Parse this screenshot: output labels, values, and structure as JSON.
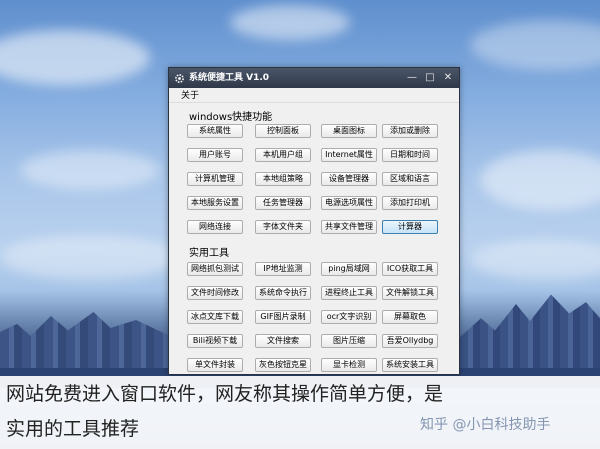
{
  "window": {
    "title": "系统便捷工具 V1.0",
    "minimize_glyph": "—",
    "maximize_glyph": "□",
    "close_glyph": "✕",
    "app_icon": "gear-icon"
  },
  "menu": {
    "about": "关于"
  },
  "group1": {
    "label": "windows快捷功能",
    "rows": [
      [
        "系统属性",
        "控制面板",
        "桌面图标",
        "添加或删除"
      ],
      [
        "用户账号",
        "本机用户组",
        "Internet属性",
        "日期和时间"
      ],
      [
        "计算机管理",
        "本地组策略",
        "设备管理器",
        "区域和语言"
      ],
      [
        "本地服务设置",
        "任务管理器",
        "电源选项属性",
        "添加打印机"
      ],
      [
        "网络连接",
        "字体文件夹",
        "共享文件管理",
        "计算器"
      ]
    ]
  },
  "group2": {
    "label": "实用工具",
    "rows": [
      [
        "网络抓包测试",
        "IP地址监测",
        "ping局域网",
        "ICO获取工具"
      ],
      [
        "文件时间修改",
        "系统命令执行",
        "进程终止工具",
        "文件解锁工具"
      ],
      [
        "冰点文库下载",
        "GIF图片录制",
        "ocr文字识别",
        "屏幕取色"
      ],
      [
        "Bili视频下载",
        "文件搜索",
        "图片压缩",
        "吾爱Ollydbg"
      ],
      [
        "单文件封装",
        "灰色按钮克星",
        "显卡检测",
        "系统安装工具"
      ]
    ]
  },
  "caption": {
    "line1": "网站免费进入窗口软件，网友称其操作简单方便，是",
    "line2": "实用的工具推荐"
  },
  "watermark": "知乎 @小白科技助手",
  "colors": {
    "titlebar": "#2e3848",
    "window_bg": "#f0f0f0",
    "button_border": "#adadad",
    "active_border": "#3c7fb1"
  }
}
